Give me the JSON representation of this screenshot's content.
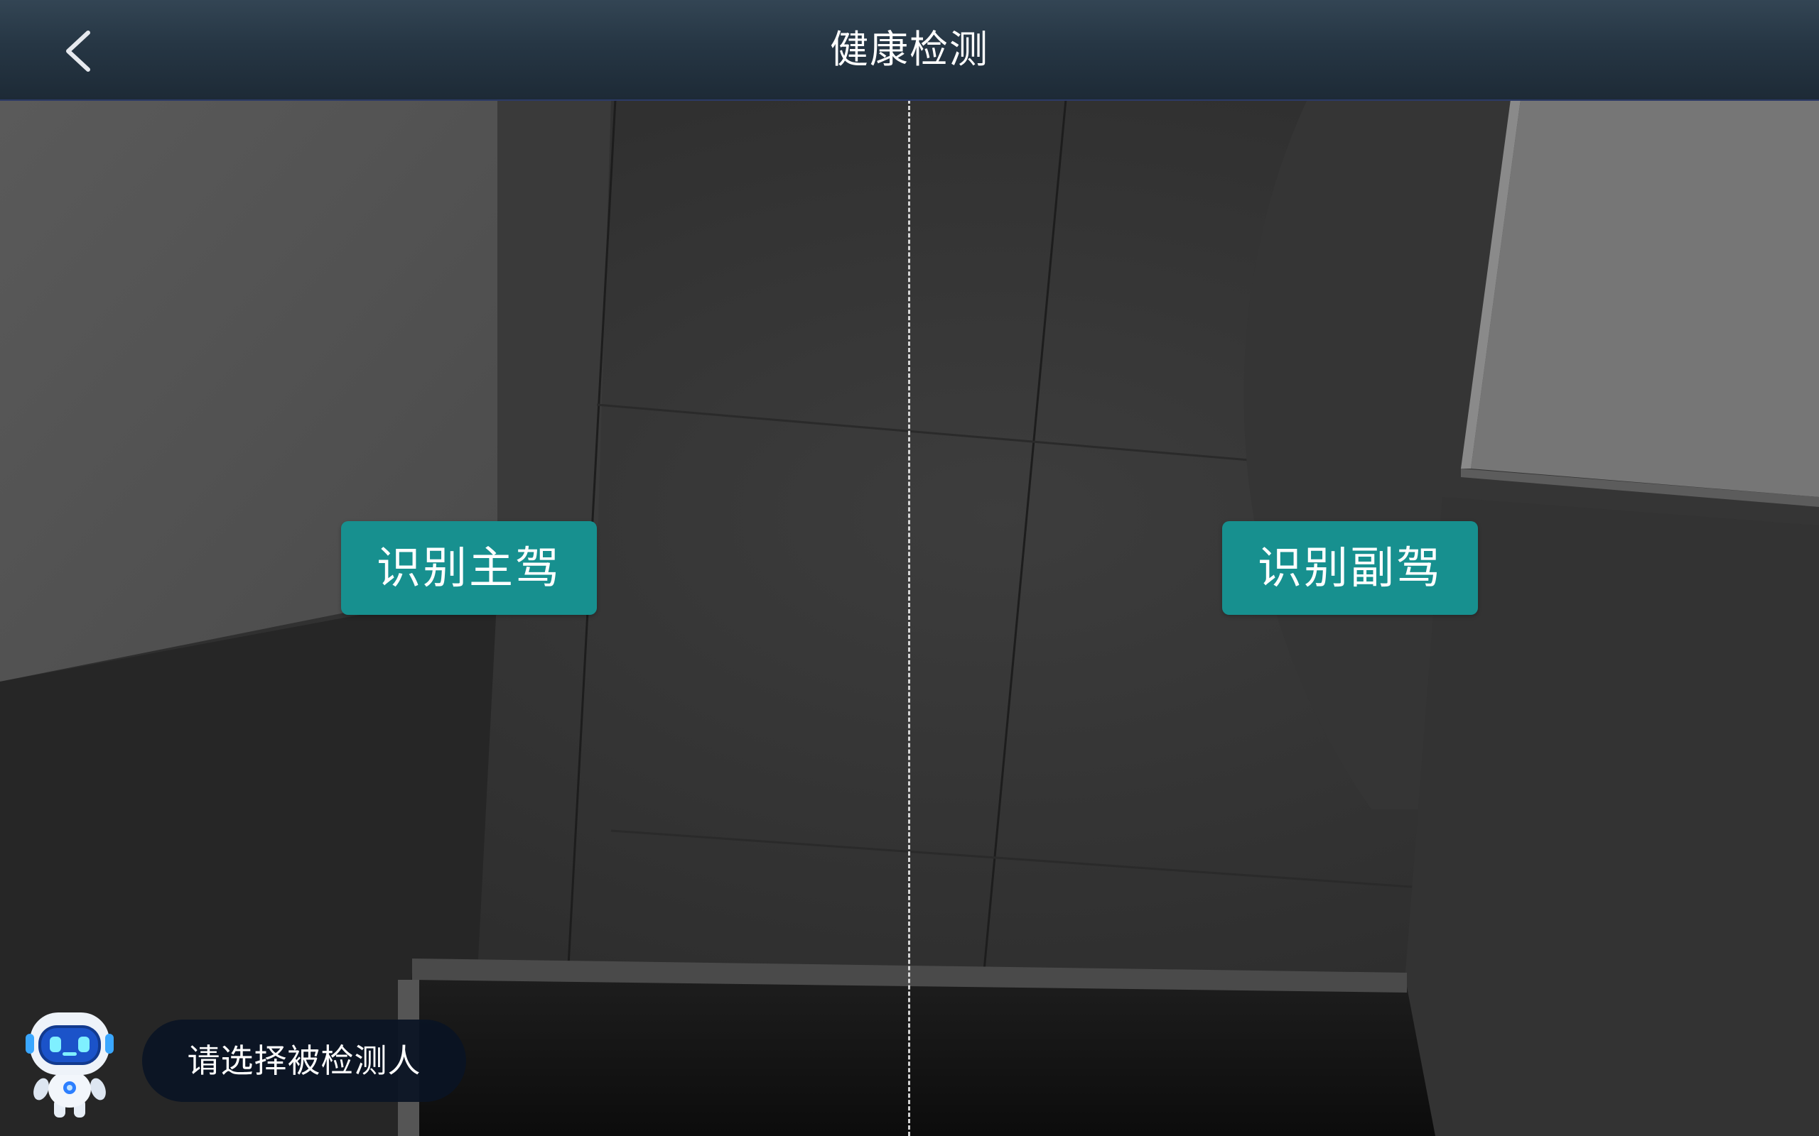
{
  "header": {
    "title": "健康检测",
    "back_icon": "chevron-left-icon"
  },
  "camera": {
    "divider": "dashed-vertical"
  },
  "buttons": {
    "identify_driver": "识别主驾",
    "identify_copilot": "识别副驾"
  },
  "assistant": {
    "avatar_icon": "robot-assistant-icon",
    "prompt": "请选择被检测人"
  },
  "colors": {
    "header_bg": "#263644",
    "button_bg": "#17908f",
    "bubble_bg": "#0a1424"
  }
}
